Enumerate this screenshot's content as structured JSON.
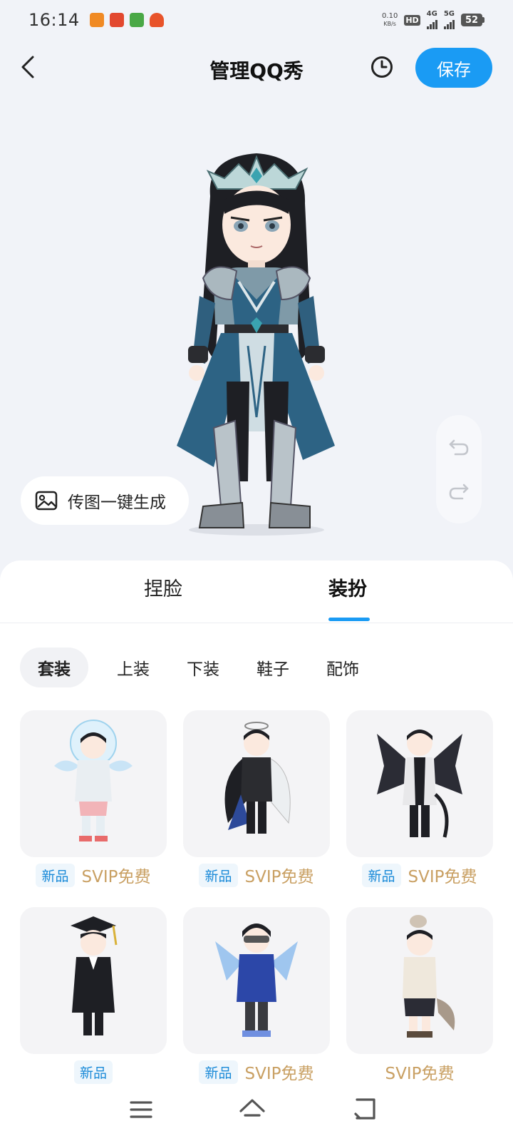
{
  "status_bar": {
    "time": "16:14",
    "net_speed_value": "0.10",
    "net_speed_unit": "KB/s",
    "hd_label": "HD",
    "sim_label": "4G",
    "sim2_label": "5G",
    "battery": "52"
  },
  "header": {
    "title": "管理QQ秀",
    "save_label": "保存"
  },
  "upload": {
    "label": "传图一键生成"
  },
  "panel": {
    "tabs": [
      "捏脸",
      "装扮"
    ],
    "active_tab": "装扮",
    "categories": [
      "套装",
      "上装",
      "下装",
      "鞋子",
      "配饰"
    ],
    "active_category": "套装",
    "items": [
      {
        "new_tag": "新品",
        "price": "SVIP免费",
        "theme": "fishbowl-angel"
      },
      {
        "new_tag": "新品",
        "price": "SVIP免费",
        "theme": "halo-feather"
      },
      {
        "new_tag": "新品",
        "price": "SVIP免费",
        "theme": "dark-wings"
      },
      {
        "new_tag": "新品",
        "price": "",
        "theme": "graduation"
      },
      {
        "new_tag": "新品",
        "price": "SVIP免费",
        "theme": "cyber-wings"
      },
      {
        "new_tag": "",
        "price": "SVIP免费",
        "theme": "raccoon-tail"
      }
    ]
  },
  "colors": {
    "accent": "#1a9bf4",
    "svip_gold": "#c9a063",
    "background": "#f1f3f8"
  }
}
